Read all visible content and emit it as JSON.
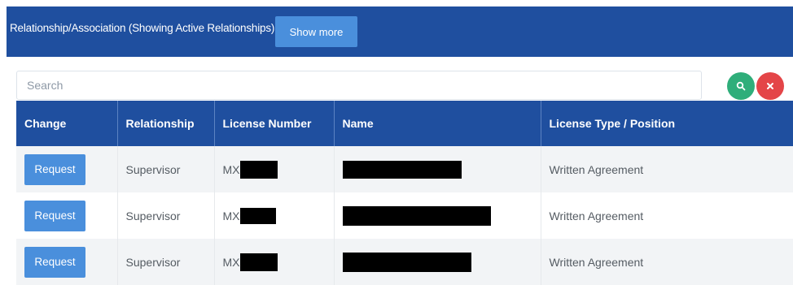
{
  "header": {
    "title": "Relationship/Association  (Showing Active Relationships)",
    "show_more_label": "Show more"
  },
  "search": {
    "placeholder": "Search",
    "search_icon": "search-icon",
    "clear_icon": "close-icon"
  },
  "table": {
    "columns": [
      "Change",
      "Relationship",
      "License Number",
      "Name",
      "License Type / Position"
    ],
    "rows": [
      {
        "change": "Request",
        "relationship": "Supervisor",
        "license_prefix": "MX",
        "license_redacted": true,
        "name_redacted": true,
        "license_type": "Written Agreement"
      },
      {
        "change": "Request",
        "relationship": "Supervisor",
        "license_prefix": "MX",
        "license_redacted": true,
        "name_redacted": true,
        "license_type": "Written Agreement"
      },
      {
        "change": "Request",
        "relationship": "Supervisor",
        "license_prefix": "MX",
        "license_redacted": true,
        "name_redacted": true,
        "license_type": "Written Agreement"
      }
    ]
  },
  "colors": {
    "header_bg": "#1f4f9f",
    "button_blue": "#4a8fdc",
    "search_green": "#2fae7a",
    "clear_red": "#e44548"
  }
}
